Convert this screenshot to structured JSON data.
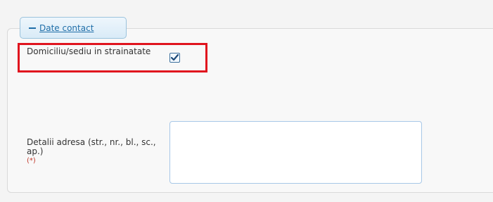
{
  "section": {
    "toggle_label": "Date contact"
  },
  "abroad": {
    "label": "Domiciliu/sediu in strainatate",
    "checked": true
  },
  "address": {
    "label": "Detalii adresa (str., nr., bl., sc., ap.)",
    "required_marker": "(*)",
    "value": ""
  },
  "colors": {
    "accent": "#1f6ea8",
    "highlight": "#e0141e",
    "required": "#c0392b"
  }
}
